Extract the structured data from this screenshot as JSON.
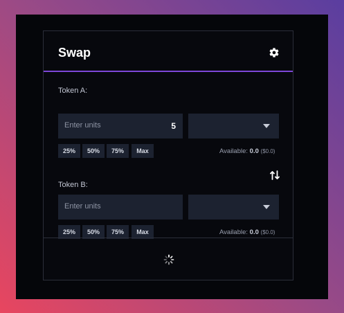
{
  "header": {
    "title": "Swap",
    "settings_icon": "gear-icon"
  },
  "token_a": {
    "label": "Token A:",
    "input_placeholder": "Enter units",
    "input_value": "5",
    "select_value": "",
    "percent_buttons": [
      "25%",
      "50%",
      "75%",
      "Max"
    ],
    "available_label": "Available:",
    "available_amount": "0.0",
    "available_usd": "($0.0)"
  },
  "swap_icon": "swap-direction-icon",
  "token_b": {
    "label": "Token B:",
    "input_placeholder": "Enter units",
    "input_value": "",
    "select_value": "",
    "percent_buttons": [
      "25%",
      "50%",
      "75%",
      "Max"
    ],
    "available_label": "Available:",
    "available_amount": "0.0",
    "available_usd": "($0.0)"
  },
  "footer": {
    "loading_icon": "spinner-icon"
  },
  "colors": {
    "accent": "#7d47d8",
    "panel": "#1c2230",
    "background": "#05060a"
  }
}
